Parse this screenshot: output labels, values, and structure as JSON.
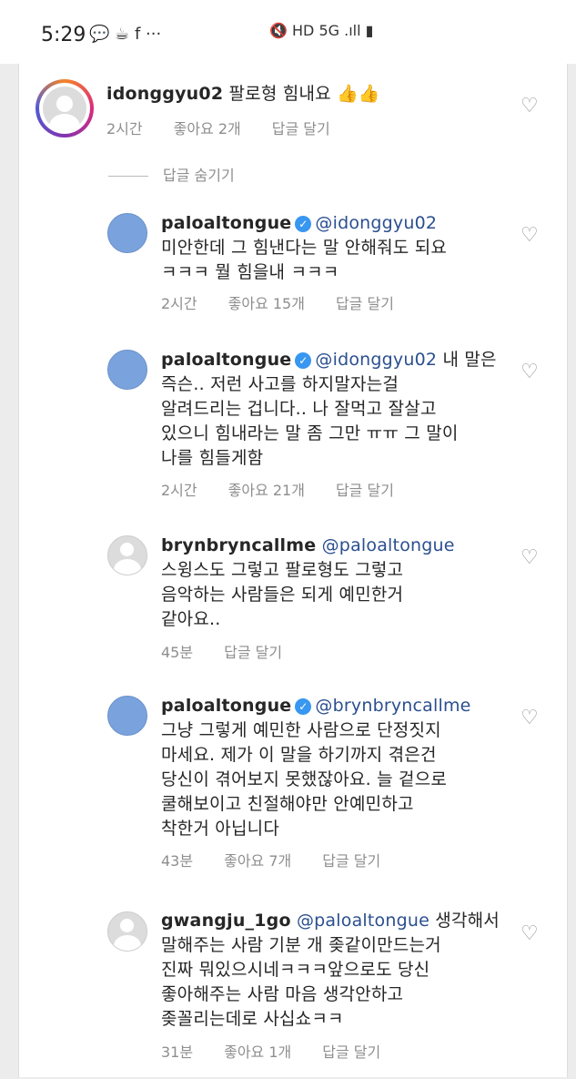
{
  "status": {
    "time": "5:29",
    "left_icons": "💬 ☕ f ···",
    "right_icons": "🔇 HD 5G .ıll ▮"
  },
  "comments": [
    {
      "username": "idonggyu02",
      "text": "팔로형 힘내요 👍👍",
      "time": "2시간",
      "likes": "좋아요 2개",
      "reply": "답글 달기"
    },
    {
      "username": "paloaltongue",
      "mention": "@idonggyu02",
      "text": "미안한데 그 힘낸다는 말 안해줘도 되요\nㅋㅋㅋ 뭘 힘을내 ㅋㅋㅋ",
      "time": "2시간",
      "likes": "좋아요 15개",
      "reply": "답글 달기"
    },
    {
      "username": "paloaltongue",
      "mention": "@idonggyu02",
      "text_first": "내 말은",
      "text": "즉슨.. 저런 사고를 하지말자는걸\n알려드리는 겁니다.. 나 잘먹고 잘살고\n있으니 힘내라는 말 좀 그만 ㅠㅠ 그 말이\n나를 힘들게함",
      "time": "2시간",
      "likes": "좋아요 21개",
      "reply": "답글 달기"
    },
    {
      "username": "brynbryncallme",
      "mention": "@paloaltongue",
      "text": "스윙스도 그렇고 팔로형도 그렇고\n음악하는 사람들은 되게 예민한거\n같아요..",
      "time": "45분",
      "reply": "답글 달기"
    },
    {
      "username": "paloaltongue",
      "mention": "@brynbryncallme",
      "text": "그냥 그렇게 예민한 사람으로 단정짓지\n마세요. 제가 이 말을 하기까지 겪은건\n당신이 겪어보지 못했잖아요. 늘 겉으로\n쿨해보이고 친절해야만 안예민하고\n착한거 아닙니다",
      "time": "43분",
      "likes": "좋아요 7개",
      "reply": "답글 달기"
    },
    {
      "username": "gwangju_1go",
      "mention": "@paloaltongue",
      "text_first": "생각해서",
      "text": "말해주는 사람 기분 개 좆같이만드는거\n진짜 뭐있으시네ㅋㅋㅋ앞으로도 당신\n좋아해주는 사람 마음 생각안하고\n좆꼴리는데로 사십쇼ㅋㅋ",
      "time": "31분",
      "likes": "좋아요 1개",
      "reply": "답글 달기"
    }
  ],
  "hide_replies": "답글 숨기기"
}
